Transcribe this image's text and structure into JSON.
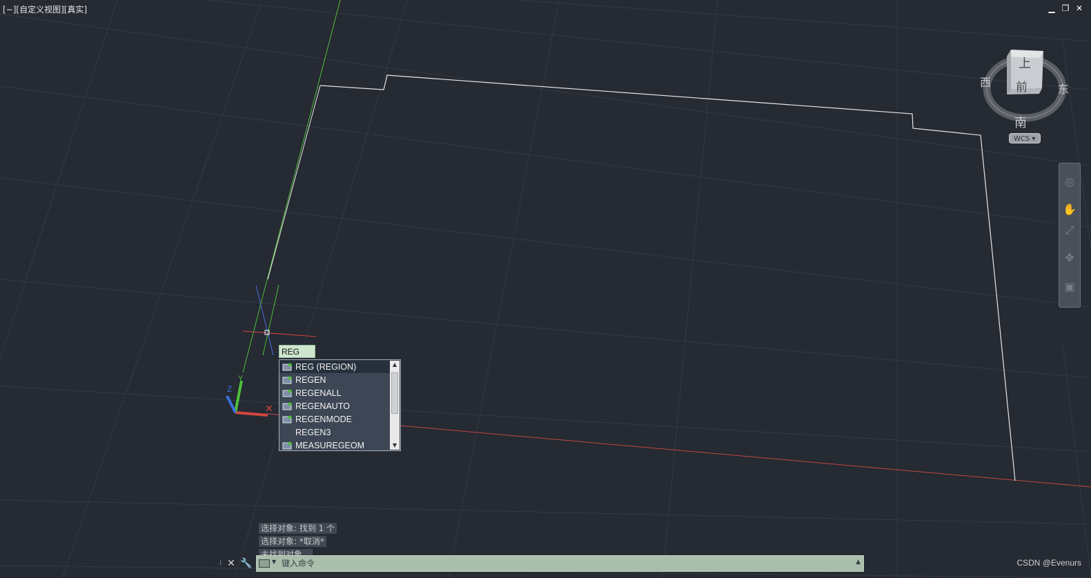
{
  "viewport": {
    "label": "[−][自定义视图][真实]",
    "controls": {
      "minimize": "▁",
      "restore": "❐",
      "close": "✕"
    },
    "background": "#252a33"
  },
  "viewcube": {
    "face_top": "上",
    "face_front": "前",
    "north": "",
    "west": "西",
    "east": "东",
    "south": "南",
    "wcs_label": "WCS ▾"
  },
  "navbar": {
    "tools": [
      "steering-wheel-icon",
      "pan-hand-icon",
      "zoom-icon",
      "orbit-icon",
      "showmotion-icon"
    ]
  },
  "dynamic_input": {
    "value": "REG"
  },
  "autocomplete": {
    "items": [
      {
        "label": "REG (REGION)",
        "icon": "region-icon",
        "selected": true
      },
      {
        "label": "REGEN",
        "icon": "regen-icon",
        "selected": false
      },
      {
        "label": "REGENALL",
        "icon": "regenall-icon",
        "selected": false
      },
      {
        "label": "REGENAUTO",
        "icon": "regenauto-icon",
        "selected": false
      },
      {
        "label": "REGENMODE",
        "icon": "regenmode-icon",
        "selected": false
      },
      {
        "label": "REGEN3",
        "icon": "",
        "selected": false
      },
      {
        "label": "MEASUREGEOM",
        "icon": "measure-icon",
        "selected": false
      }
    ]
  },
  "command_history": [
    "选择对象: 找到 1 个",
    "选择对象: *取消*",
    "未找到对象。"
  ],
  "command_line": {
    "placeholder": "键入命令",
    "close": "✕",
    "customize": "🔧",
    "expand": "▲"
  },
  "watermark": "CSDN @Evenurs",
  "colors": {
    "x_axis": "#d4453e",
    "y_axis": "#4fbf3a",
    "z_axis": "#3d6ee0",
    "outline": "#e8e8e8"
  }
}
